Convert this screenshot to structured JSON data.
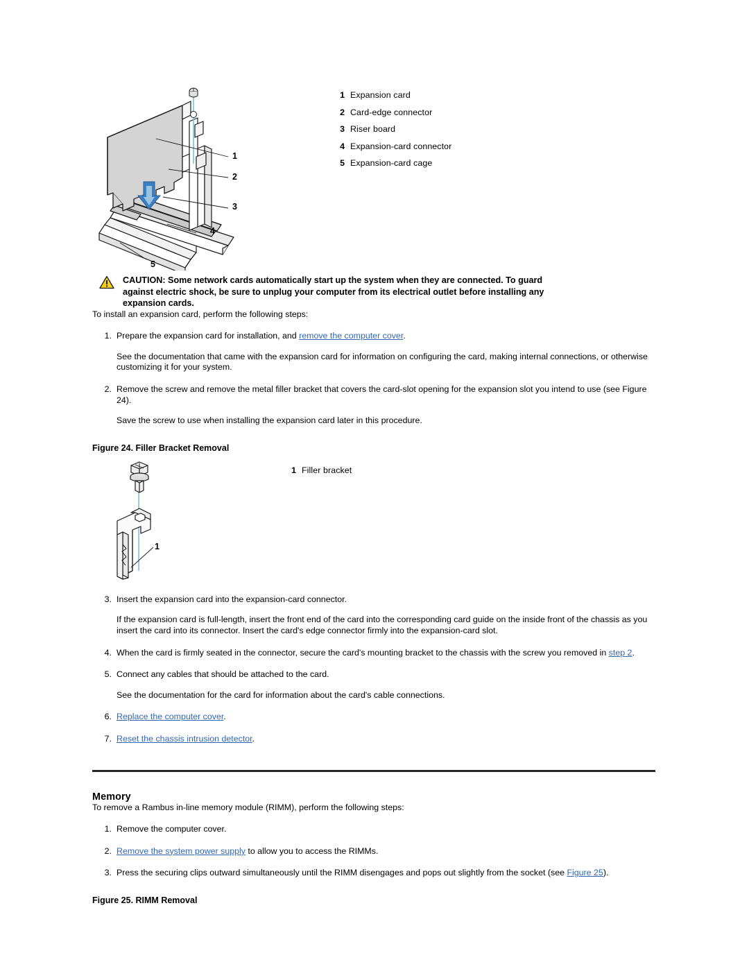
{
  "figure_expansion": {
    "legend": [
      {
        "num": "1",
        "label": "Expansion card"
      },
      {
        "num": "2",
        "label": "Card-edge connector"
      },
      {
        "num": "3",
        "label": "Riser board"
      },
      {
        "num": "4",
        "label": "Expansion-card connector"
      },
      {
        "num": "5",
        "label": "Expansion-card cage"
      }
    ],
    "callouts": [
      "1",
      "2",
      "3",
      "4",
      "5"
    ],
    "colors": {
      "arrow_blue": "#3a7fc4",
      "screw_line_cyan": "#7fc4dd",
      "card_fill": "#d7d7d7",
      "outline": "#1a1a1a"
    }
  },
  "caution": {
    "icon": "warning-triangle-icon",
    "icon_color": "#f5d018",
    "text": "CAUTION: Some network cards automatically start up the system when they are connected. To guard against electric shock, be sure to unplug your computer from its electrical outlet before installing any expansion cards."
  },
  "install": {
    "intro": "To install an expansion card, perform the following steps:",
    "steps": [
      {
        "num": "1.",
        "text_before": "Prepare the expansion card for installation, and ",
        "link": "remove the computer cover",
        "text_after": ".",
        "sub": "See the documentation that came with the expansion card for information on configuring the card, making internal connections, or otherwise customizing it for your system."
      },
      {
        "num": "2.",
        "text_before": "Remove the screw and remove the metal filler bracket that covers the card-slot opening for the expansion slot you intend to use (see Figure 24).",
        "link": "",
        "text_after": "",
        "sub": "Save the screw to use when installing the expansion card later in this procedure."
      },
      {
        "num": "3.",
        "text_before": "Insert the expansion card into the expansion-card connector.",
        "link": "",
        "text_after": "",
        "sub": "If the expansion card is full-length, insert the front end of the card into the corresponding card guide on the inside front of the chassis as you insert the card into its connector. Insert the card's edge connector firmly into the expansion-card slot."
      },
      {
        "num": "4.",
        "text_before": "When the card is firmly seated in the connector, secure the card's mounting bracket to the chassis with the screw you removed in ",
        "link": "step 2",
        "text_after": ".",
        "sub": ""
      },
      {
        "num": "5.",
        "text_before": "Connect any cables that should be attached to the card.",
        "link": "",
        "text_after": "",
        "sub": "See the documentation for the card for information about the card's cable connections."
      },
      {
        "num": "6.",
        "text_before": "",
        "link": "Replace the computer cover",
        "text_after": ".",
        "sub": ""
      },
      {
        "num": "7.",
        "text_before": "",
        "link": "Reset the chassis intrusion detector",
        "text_after": ".",
        "sub": ""
      }
    ]
  },
  "figure24": {
    "caption": "Figure 24. Filler Bracket Removal",
    "legend": [
      {
        "num": "1",
        "label": "Filler bracket"
      }
    ],
    "callouts": [
      "1"
    ]
  },
  "memory": {
    "heading": "Memory",
    "intro": "To remove a Rambus in-line memory module (RIMM), perform the following steps:",
    "steps": [
      {
        "num": "1.",
        "text_before": "Remove the computer cover.",
        "link": "",
        "text_after": "",
        "sub": ""
      },
      {
        "num": "2.",
        "text_before": "",
        "link": "Remove the system power supply",
        "text_after": " to allow you to access the RIMMs.",
        "sub": ""
      },
      {
        "num": "3.",
        "text_before": "Press the securing clips outward simultaneously until the RIMM disengages and pops out slightly from the socket (see ",
        "link": "Figure 25",
        "text_after": ").",
        "sub": ""
      }
    ]
  },
  "figure25": {
    "caption": "Figure 25. RIMM Removal"
  }
}
